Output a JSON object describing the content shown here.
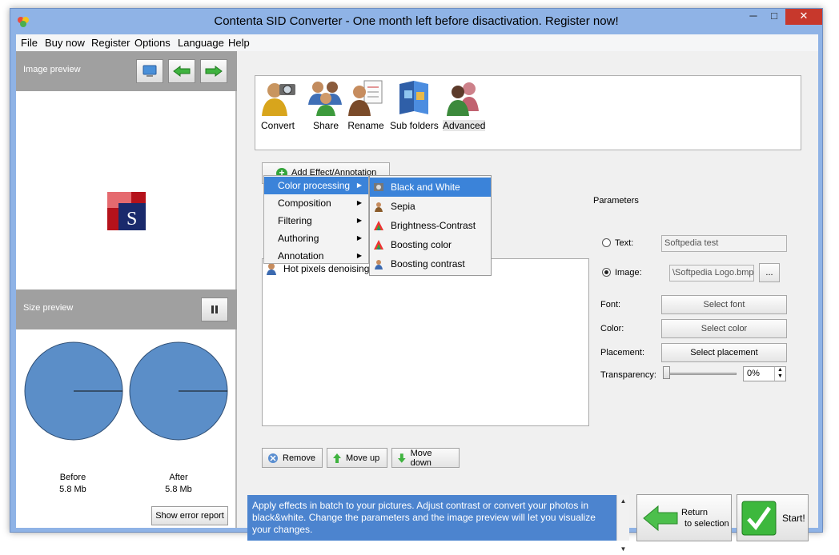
{
  "window": {
    "title": "Contenta SID Converter  - One month left before disactivation. Register now!",
    "minimize_glyph": "─",
    "maximize_glyph": "□",
    "close_glyph": "✕"
  },
  "menubar": {
    "items": [
      "File",
      "Buy now",
      "Register",
      "Options",
      "Language",
      "Help"
    ]
  },
  "left_panel": {
    "image_preview_title": "Image preview",
    "size_preview_title": "Size preview",
    "before_label": "Before",
    "before_size": "5.8 Mb",
    "after_label": "After",
    "after_size": "5.8 Mb",
    "error_button": "Show error report",
    "preview_letter": "S"
  },
  "toolbar": {
    "items": [
      {
        "label": "Convert",
        "icon": "camera-person-icon"
      },
      {
        "label": "Share",
        "icon": "people-icon"
      },
      {
        "label": "Rename",
        "icon": "rename-person-icon"
      },
      {
        "label": "Sub folders",
        "icon": "folders-icon"
      },
      {
        "label": "Advanced",
        "icon": "advanced-people-icon"
      }
    ]
  },
  "effects": {
    "add_button": "Add Effect/Annotation",
    "list_items": [
      "Hot pixels denoising"
    ],
    "remove_button": "Remove",
    "move_up_button": "Move up",
    "move_down_button": "Move down"
  },
  "add_menu": {
    "items": [
      "Color processing",
      "Composition",
      "Filtering",
      "Authoring",
      "Annotation"
    ],
    "highlighted": "Color processing"
  },
  "color_submenu": {
    "items": [
      "Black and White",
      "Sepia",
      "Brightness-Contrast",
      "Boosting color",
      "Boosting contrast"
    ],
    "highlighted": "Black and White"
  },
  "parameters": {
    "title": "Parameters",
    "text_label": "Text:",
    "text_value": "Softpedia test",
    "image_label": "Image:",
    "image_value": "\\Softpedia Logo.bmp",
    "browse_button": "...",
    "font_label": "Font:",
    "font_button": "Select font",
    "color_label": "Color:",
    "color_button": "Select color",
    "placement_label": "Placement:",
    "placement_button": "Select placement",
    "transparency_label": "Transparency:",
    "transparency_value": "0%",
    "selected_mode": "image"
  },
  "info": {
    "text": "Apply effects in batch to your pictures. Adjust contrast or convert your photos in black&white. Change the parameters and the image preview will let you visualize your changes."
  },
  "bottom": {
    "return_line1": "Return",
    "return_line2": "to selection",
    "start_button": "Start!"
  },
  "colors": {
    "accent": "#3b83d9",
    "pie_fill": "#5b8ec8",
    "info_bg": "#4c84cf",
    "titlebar": "#8fb3e6",
    "close_red": "#c7382c"
  }
}
